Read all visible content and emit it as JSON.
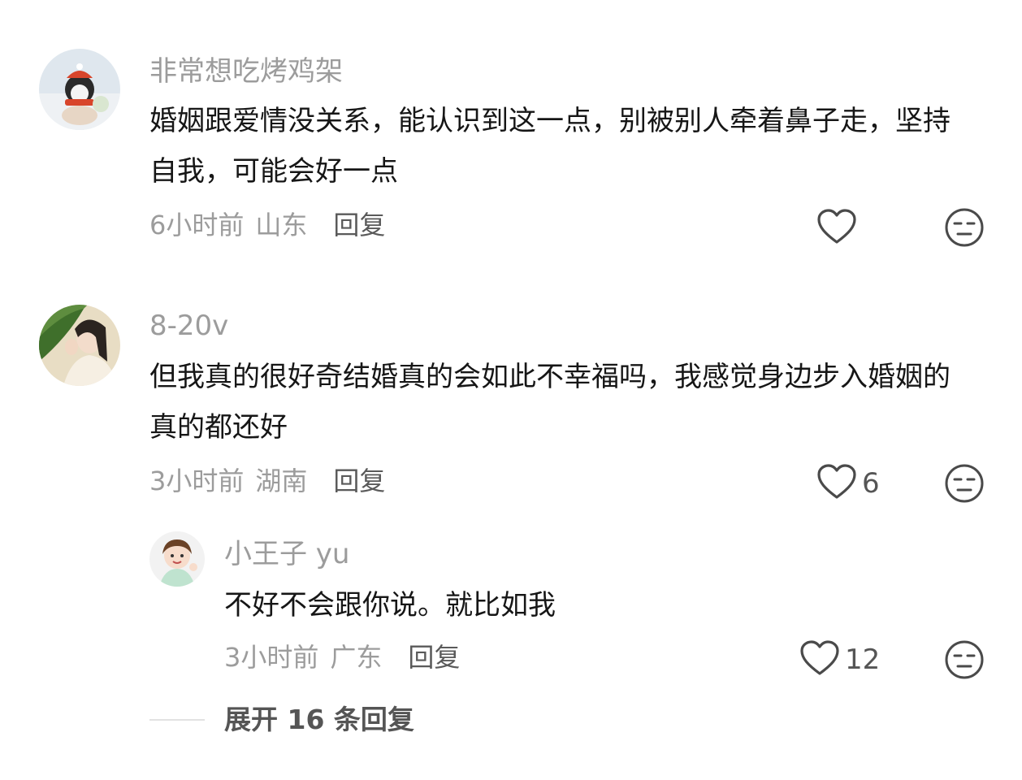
{
  "comments": [
    {
      "username": "非常想吃烤鸡架",
      "content": "婚姻跟爱情没关系，能认识到这一点，别被别人牵着鼻子走，坚持自我，可能会好一点",
      "time": "6小时前",
      "location": "山东",
      "reply_label": "回复",
      "likes": ""
    },
    {
      "username": "8-20v",
      "content": "但我真的很好奇结婚真的会如此不幸福吗，我感觉身边步入婚姻的真的都还好",
      "time": "3小时前",
      "location": "湖南",
      "reply_label": "回复",
      "likes": "6"
    }
  ],
  "reply": {
    "username": "小王子 yu",
    "content": "不好不会跟你说。就比如我",
    "time": "3小时前",
    "location": "广东",
    "reply_label": "回复",
    "likes": "12"
  },
  "expand_label": "展开 16 条回复",
  "icons": {
    "like": "heart-outline-icon",
    "dislike": "meh-face-icon"
  },
  "colors": {
    "text": "#161616",
    "secondary": "#9c9c9c",
    "icon": "#4a4a4a"
  }
}
